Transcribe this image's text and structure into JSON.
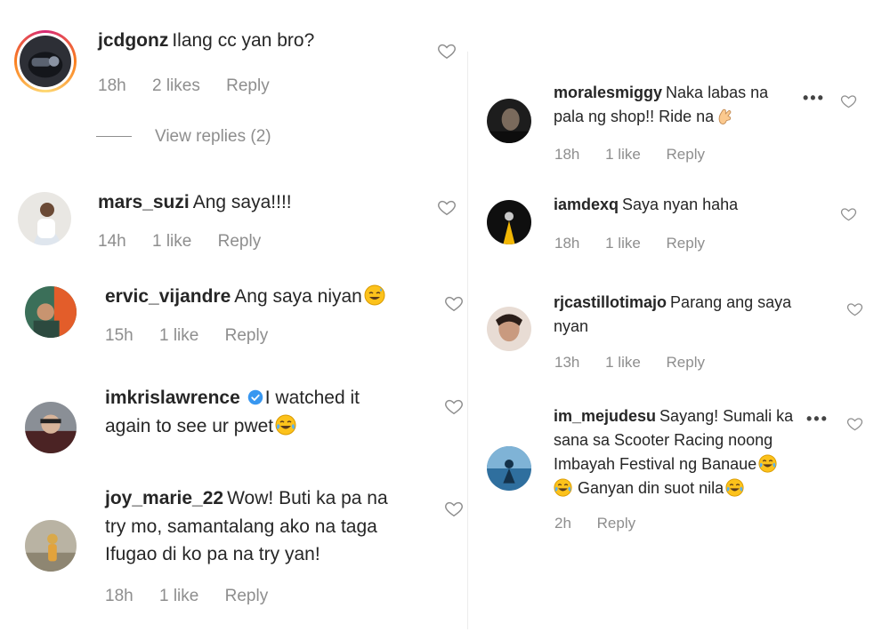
{
  "left_comments": [
    {
      "username": "jcdgonz",
      "lines": [
        "Ilang cc yan bro?"
      ],
      "time": "18h",
      "likes": "2 likes",
      "reply": "Reply",
      "view_replies": "View replies (2)"
    },
    {
      "username": "mars_suzi",
      "lines": [
        "Ang saya!!!!"
      ],
      "time": "14h",
      "likes": "1 like",
      "reply": "Reply"
    },
    {
      "username": "ervic_vijandre",
      "lines": [
        "Ang saya niyan"
      ],
      "time": "15h",
      "likes": "1 like",
      "reply": "Reply"
    },
    {
      "username": "imkrislawrence",
      "lines": [
        "I watched it",
        "again to see ur pwet"
      ],
      "time": "",
      "likes": "",
      "reply": ""
    },
    {
      "username": "joy_marie_22",
      "lines": [
        "Wow! Buti ka pa na",
        "try mo, samantalang ako na taga",
        "Ifugao di ko pa na try yan!"
      ],
      "time": "18h",
      "likes": "1 like",
      "reply": "Reply"
    }
  ],
  "right_comments": [
    {
      "username": "moralesmiggy",
      "lines": [
        "Naka labas na",
        "pala ng shop!! Ride na"
      ],
      "time": "18h",
      "likes": "1 like",
      "reply": "Reply"
    },
    {
      "username": "iamdexq",
      "lines": [
        "Saya nyan haha"
      ],
      "time": "18h",
      "likes": "1 like",
      "reply": "Reply"
    },
    {
      "username": "rjcastillotimajo",
      "lines": [
        "Parang ang saya",
        "nyan"
      ],
      "time": "13h",
      "likes": "1 like",
      "reply": "Reply"
    },
    {
      "username": "im_mejudesu",
      "lines": [
        "Sayang! Sumali ka",
        "sana sa Scooter Racing noong",
        "Imbayah Festival ng Banaue",
        "Ganyan din suot nila"
      ],
      "time": "2h",
      "likes": "",
      "reply": "Reply"
    }
  ],
  "icons": {
    "heart": "heart-outline-icon",
    "more": "more-options-icon",
    "verified": "verified-badge-icon",
    "emoji_laugh": "grinning-sweat-emoji",
    "emoji_tears": "tears-of-joy-emoji",
    "emoji_hand": "pinched-fingers-emoji"
  },
  "colors": {
    "text": "#262626",
    "meta": "#8e8e8e",
    "verified": "#3897f0",
    "story_ring": "#d62976"
  }
}
